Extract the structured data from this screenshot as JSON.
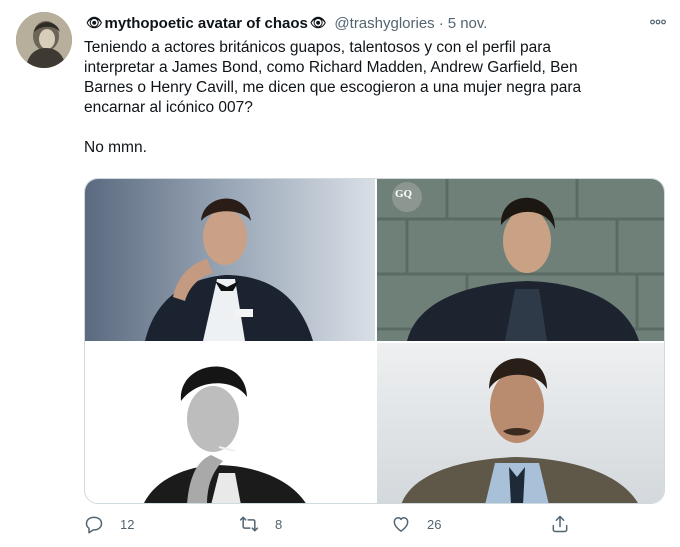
{
  "tweet": {
    "display_name": "mythopoetic avatar of chaos",
    "name_emoji": "👁",
    "handle": "@trashyglories",
    "separator": "·",
    "date": "5 nov.",
    "more_icon": "more-horizontal-icon",
    "text": "Teniendo a actores británicos guapos, talentosos y con el perfil para\ninterpretar a James Bond, como Richard Madden, Andrew Garfield, Ben\nBarnes o Henry Cavill, me dicen que escogieron a una mujer negra para\nencarnar al icónico 007?\n\nNo mmn.",
    "photos": [
      {
        "icon": "photo-man-in-tuxedo"
      },
      {
        "icon": "photo-man-dark-jacket-gq",
        "watermark": "GQ"
      },
      {
        "icon": "photo-man-smoking-bw"
      },
      {
        "icon": "photo-man-mustache-jacket"
      }
    ],
    "actions": {
      "reply": {
        "icon": "reply-icon",
        "count": "12"
      },
      "retweet": {
        "icon": "retweet-icon",
        "count": "8"
      },
      "like": {
        "icon": "heart-icon",
        "count": "26"
      },
      "share": {
        "icon": "share-icon"
      }
    }
  },
  "colors": {
    "text": "#0f1419",
    "secondary": "#536471",
    "border": "#cfd9de"
  }
}
